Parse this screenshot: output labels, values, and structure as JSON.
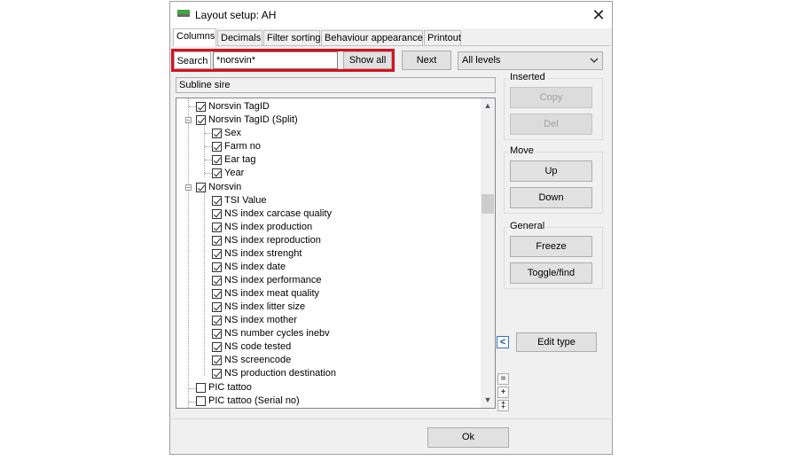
{
  "window": {
    "title": "Layout setup: AH"
  },
  "tabs": [
    {
      "label": "Columns",
      "active": true
    },
    {
      "label": "Decimals"
    },
    {
      "label": "Filter sorting"
    },
    {
      "label": "Behaviour  appearance"
    },
    {
      "label": "Printout"
    }
  ],
  "search": {
    "label": "Search",
    "value": "*norsvin*",
    "show_all_label": "Show all"
  },
  "next_label": "Next",
  "levels": {
    "selected": "All levels"
  },
  "subline_label": "Subline sire",
  "tree": [
    {
      "label": "Norsvin TagID",
      "checked": true
    },
    {
      "label": "Norsvin TagID (Split)",
      "checked": true
    },
    {
      "label": "Sex",
      "checked": true
    },
    {
      "label": "Farm no",
      "checked": true
    },
    {
      "label": "Ear tag",
      "checked": true
    },
    {
      "label": "Year",
      "checked": true
    },
    {
      "label": "Norsvin",
      "checked": true
    },
    {
      "label": "TSI Value",
      "checked": true
    },
    {
      "label": "NS index carcase quality",
      "checked": true
    },
    {
      "label": "NS index production",
      "checked": true
    },
    {
      "label": "NS index reproduction",
      "checked": true
    },
    {
      "label": "NS index strenght",
      "checked": true
    },
    {
      "label": "NS index date",
      "checked": true
    },
    {
      "label": "NS index performance",
      "checked": true
    },
    {
      "label": "NS index meat quality",
      "checked": true
    },
    {
      "label": "NS index litter size",
      "checked": true
    },
    {
      "label": "NS index mother",
      "checked": true
    },
    {
      "label": "NS number cycles inebv",
      "checked": true
    },
    {
      "label": "NS code tested",
      "checked": true
    },
    {
      "label": "NS screencode",
      "checked": true
    },
    {
      "label": "NS production destination",
      "checked": true
    },
    {
      "label": "PIC tattoo",
      "checked": false
    },
    {
      "label": "PIC tattoo (Serial no)",
      "checked": false
    }
  ],
  "inserted": {
    "label": "Inserted",
    "copy": "Copy",
    "del": "Del"
  },
  "move": {
    "label": "Move",
    "up": "Up",
    "down": "Down"
  },
  "general": {
    "label": "General",
    "freeze": "Freeze",
    "toggle": "Toggle/find"
  },
  "edit_type_label": "Edit type",
  "collapse_glyph": "<",
  "mini_buttons": [
    "=",
    "+",
    "‡"
  ],
  "ok_label": "Ok"
}
